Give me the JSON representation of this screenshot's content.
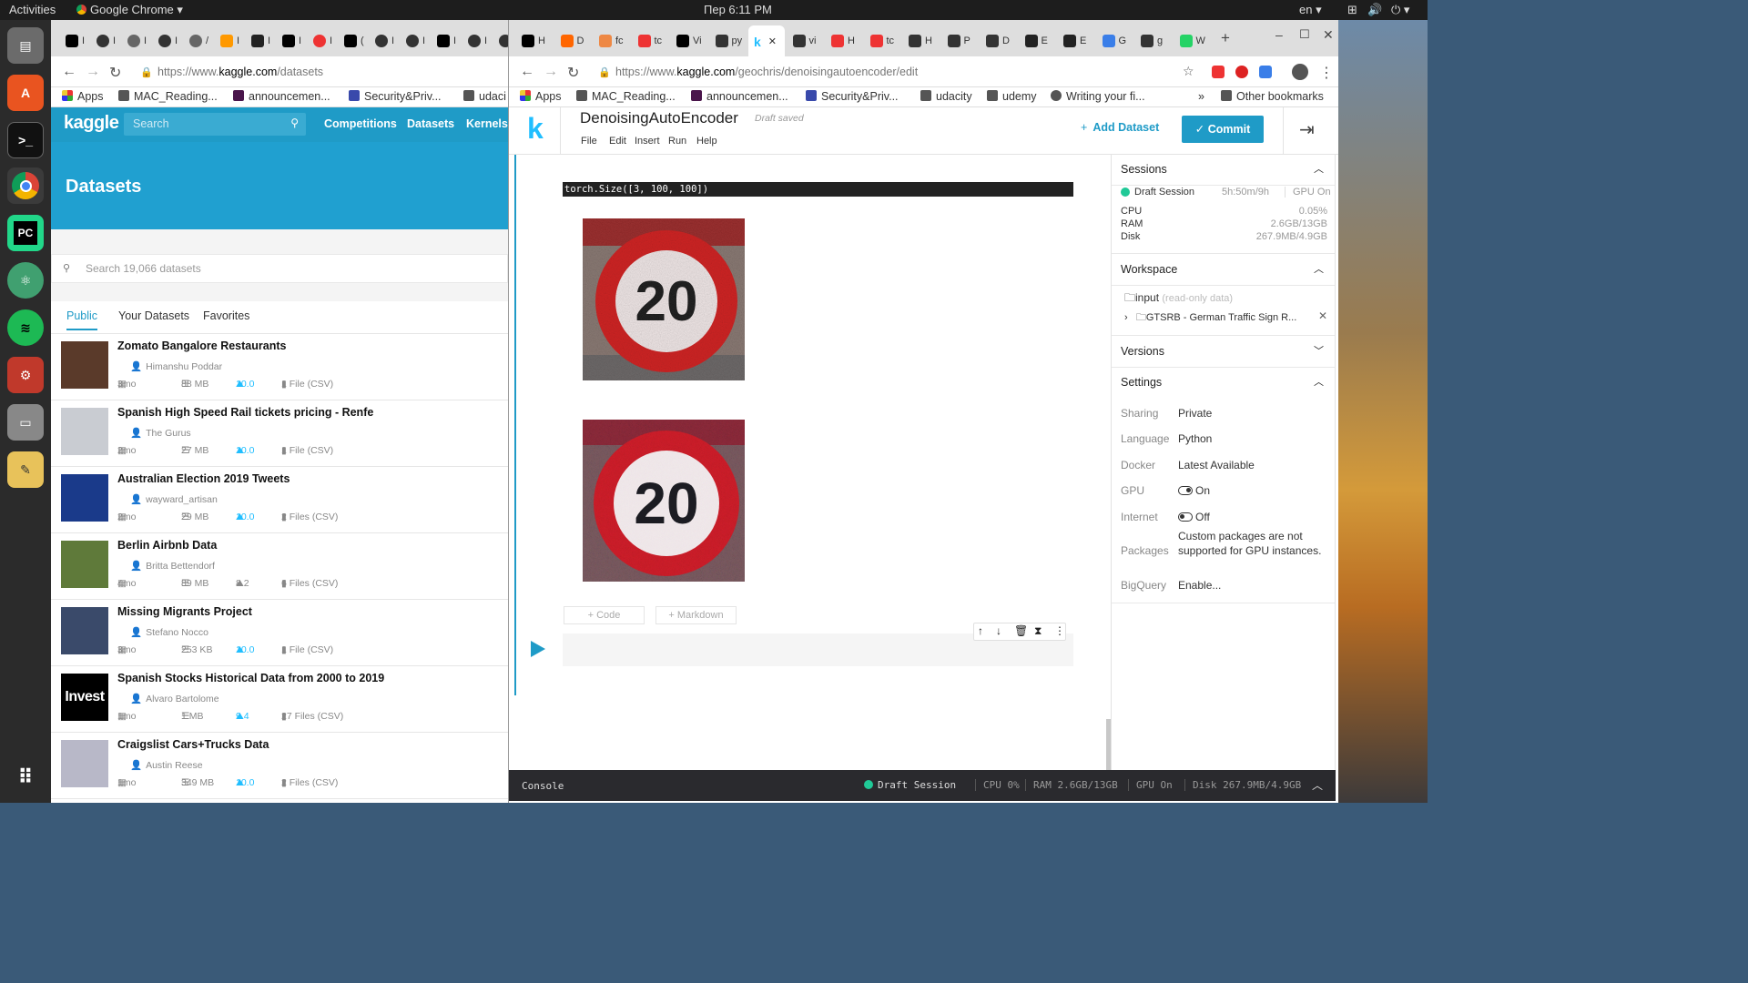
{
  "topbar": {
    "activities": "Activities",
    "app": "Google Chrome",
    "clock": "Пер  6:11 PM",
    "lang": "en"
  },
  "dock": {
    "items": [
      "files-icon",
      "software-icon",
      "terminal-icon",
      "chrome-icon",
      "pycharm-icon",
      "atom-icon",
      "spotify-icon",
      "settings-icon",
      "disk-icon",
      "text-editor-icon",
      "apps-grid-icon"
    ]
  },
  "left": {
    "url_prefix": "https://www.",
    "url_host": "kaggle.com",
    "url_path": "/datasets",
    "bookmarks": [
      "Apps",
      "MAC_Reading...",
      "announcemen...",
      "Security&Priv...",
      "udaci"
    ],
    "nav": {
      "logo": "kaggle",
      "search_placeholder": "Search",
      "links": [
        "Competitions",
        "Datasets",
        "Kernels"
      ]
    },
    "hero": "Datasets",
    "dataset_search_placeholder": "Search 19,066 datasets",
    "tabs": [
      "Public",
      "Your Datasets",
      "Favorites"
    ],
    "datasets": [
      {
        "title": "Zomato Bangalore Restaurants",
        "author": "Himanshu Poddar",
        "age": "3mo",
        "size": "88 MB",
        "score": "10.0",
        "files": "1 File (CSV)",
        "highlight": true
      },
      {
        "title": "Spanish High Speed Rail tickets pricing - Renfe",
        "author": "The Gurus",
        "age": "2mo",
        "size": "27 MB",
        "score": "10.0",
        "files": "1 File (CSV)",
        "highlight": true
      },
      {
        "title": "Australian Election 2019 Tweets",
        "author": "wayward_artisan",
        "age": "2mo",
        "size": "29 MB",
        "score": "10.0",
        "files": "2 Files (CSV)",
        "highlight": true
      },
      {
        "title": "Berlin Airbnb Data",
        "author": "Britta Bettendorf",
        "age": "4mo",
        "size": "89 MB",
        "score": "8.2",
        "files": "6 Files (CSV)",
        "highlight": false
      },
      {
        "title": "Missing Migrants Project",
        "author": "Stefano Nocco",
        "age": "3mo",
        "size": "253 KB",
        "score": "10.0",
        "files": "1 File (CSV)",
        "highlight": true
      },
      {
        "title": "Spanish Stocks Historical Data from 2000 to 2019",
        "author": "Alvaro Bartolome",
        "age": "1mo",
        "size": "1 MB",
        "score": "9.4",
        "files": "27 Files (CSV)",
        "highlight": true
      },
      {
        "title": "Craigslist Cars+Trucks Data",
        "author": "Austin Reese",
        "age": "1mo",
        "size": "349 MB",
        "score": "10.0",
        "files": "2 Files (CSV)",
        "highlight": true
      }
    ],
    "thumb_invest_text": "Invest"
  },
  "right": {
    "tabs": [
      "H",
      "D",
      "fc",
      "tc",
      "Vi",
      "py",
      "",
      "vi",
      "H",
      "tc",
      "H",
      "P",
      "D",
      "E",
      "E",
      "G",
      "g",
      "W"
    ],
    "url_prefix": "https://www.",
    "url_host": "kaggle.com",
    "url_path": "/geochris/denoisingautoencoder/edit",
    "bookmarks": [
      "Apps",
      "MAC_Reading...",
      "announcemen...",
      "Security&Priv...",
      "udacity",
      "udemy",
      "Writing your fi...",
      "»",
      "Other bookmarks"
    ],
    "kernel": {
      "logo": "k",
      "title": "DenoisingAutoEncoder",
      "status": "Draft saved",
      "menu": [
        "File",
        "Edit",
        "Insert",
        "Run",
        "Help"
      ],
      "add_dataset": "Add Dataset",
      "commit": "Commit"
    },
    "output_text": "torch.Size([3, 100, 100])",
    "sign_number": "20",
    "add_code": "+ Code",
    "add_markdown": "+ Markdown",
    "sessions": {
      "header": "Sessions",
      "session_name": "Draft Session",
      "session_time": "5h:50m/9h",
      "gpu": "GPU On",
      "stats": [
        {
          "k": "CPU",
          "v": "0.05%"
        },
        {
          "k": "RAM",
          "v": "2.6GB/13GB"
        },
        {
          "k": "Disk",
          "v": "267.9MB/4.9GB"
        }
      ]
    },
    "workspace": {
      "header": "Workspace",
      "input": "input",
      "input_note": "(read-only data)",
      "dataset": "GTSRB - German Traffic Sign R..."
    },
    "versions": {
      "header": "Versions"
    },
    "settings": {
      "header": "Settings",
      "rows": [
        {
          "k": "Sharing",
          "v": "Private"
        },
        {
          "k": "Language",
          "v": "Python"
        },
        {
          "k": "Docker",
          "v": "Latest Available"
        },
        {
          "k": "GPU",
          "v": "On"
        },
        {
          "k": "Internet",
          "v": "Off"
        },
        {
          "k": "Packages",
          "v": "Custom packages are not supported for GPU instances."
        },
        {
          "k": "BigQuery",
          "v": "Enable..."
        }
      ]
    },
    "console": {
      "label": "Console",
      "session": "Draft Session",
      "cpu": "CPU 0%",
      "ram": "RAM 2.6GB/13GB",
      "gpu": "GPU On",
      "disk": "Disk 267.9MB/4.9GB"
    }
  }
}
